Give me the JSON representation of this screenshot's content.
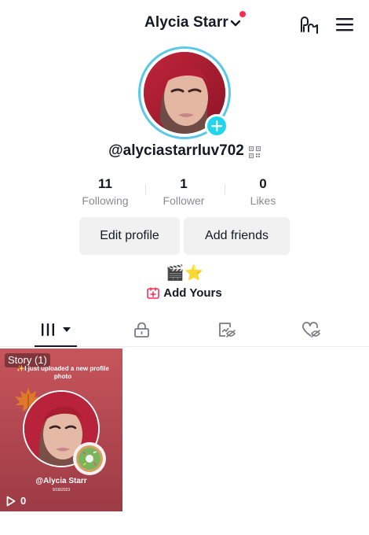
{
  "header": {
    "title": "Alycia Starr",
    "icons": {
      "dropdown": "chevron-down-icon",
      "creator": "creator-tools-icon",
      "menu": "hamburger-menu-icon"
    },
    "notification_dot_color": "#fe2c55"
  },
  "profile": {
    "username": "@alyciastarrluv702",
    "avatar_ring_color": "#5cc8e8",
    "add_badge_color": "#20d5ec"
  },
  "stats": [
    {
      "value": "11",
      "label": "Following"
    },
    {
      "value": "1",
      "label": "Follower"
    },
    {
      "value": "0",
      "label": "Likes"
    }
  ],
  "buttons": {
    "edit_profile": "Edit profile",
    "add_friends": "Add friends"
  },
  "bio": "🎬⭐",
  "add_yours": {
    "label": "Add Yours",
    "color": "#fe2c55"
  },
  "tabs": [
    {
      "name": "videos",
      "icon": "grid-icon",
      "active": true
    },
    {
      "name": "private",
      "icon": "lock-icon"
    },
    {
      "name": "reposts",
      "icon": "repost-hidden-icon"
    },
    {
      "name": "liked",
      "icon": "heart-hidden-icon"
    }
  ],
  "videos": [
    {
      "story_tag": "Story (1)",
      "caption": "✨I just uploaded a new profile photo",
      "handle": "@Alycia Starr",
      "date": "9/18/2023",
      "views": "0"
    }
  ]
}
